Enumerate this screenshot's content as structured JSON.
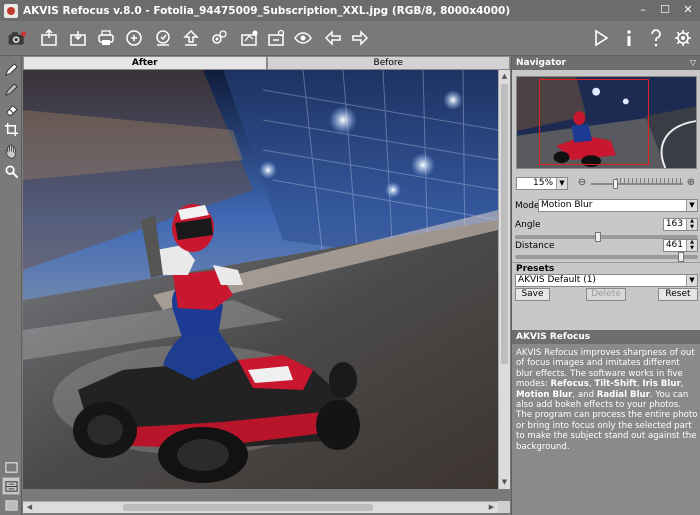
{
  "window": {
    "title": "AKVIS Refocus v.8.0 - Fotolia_94475009_Subscription_XXL.jpg (RGB/8, 8000x4000)",
    "minimize": "–",
    "maximize": "☐",
    "close": "✕"
  },
  "toolbar": {
    "left_icons": [
      "open-icon",
      "save-icon",
      "print-icon",
      "batch-icon",
      "export-icon",
      "import-icon",
      "settings-icon",
      "share-icon",
      "preview-icon",
      "before-after-icon",
      "undo-icon",
      "redo-icon"
    ],
    "right_icons": [
      "run-icon",
      "info-icon",
      "help-icon",
      "preferences-icon"
    ]
  },
  "left_tools": [
    "focus-area-pencil-icon",
    "background-pencil-icon",
    "eraser-icon",
    "crop-icon",
    "hand-icon",
    "zoom-icon"
  ],
  "tabs": {
    "after": "After",
    "before": "Before"
  },
  "navigator": {
    "title": "Navigator",
    "zoom": "15%"
  },
  "settings": {
    "mode_label": "Mode:",
    "mode_value": "Motion Blur",
    "angle_label": "Angle",
    "angle_value": "163",
    "distance_label": "Distance",
    "distance_value": "461",
    "angle_slider": 0.45,
    "distance_slider": 0.92
  },
  "presets": {
    "title": "Presets",
    "value": "AKVIS Default (1)",
    "save": "Save",
    "delete": "Delete",
    "reset": "Reset"
  },
  "help": {
    "title": "AKVIS Refocus",
    "p1": "AKVIS Refocus improves sharpness of out of focus images and imitates different blur effects. The software works in five modes: ",
    "m1": "Refocus",
    "c1": ", ",
    "m2": "Tilt-Shift",
    "c2": ", ",
    "m3": "Iris Blur",
    "c3": ", ",
    "m4": "Motion Blur",
    "c4": ", and ",
    "m5": "Radial Blur",
    "p2": ". You can also add bokeh effects to your photos. The program can process the entire photo or bring into focus only the selected part to make the subject stand out against the background."
  }
}
